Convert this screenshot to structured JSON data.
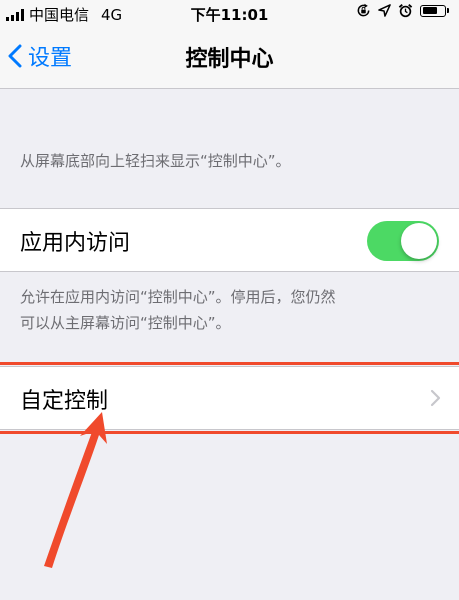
{
  "status_bar": {
    "carrier": "中国电信",
    "network": "4G",
    "time": "下午11:01",
    "icons": [
      "signal-icon",
      "orientation-lock-icon",
      "location-icon",
      "alarm-icon",
      "battery-icon"
    ]
  },
  "nav": {
    "back_label": "设置",
    "title": "控制中心"
  },
  "intro_footnote": "从屏幕底部向上轻扫来显示“控制中心”。",
  "access_in_apps": {
    "label": "应用内访问",
    "enabled": true,
    "footnote_line1": "允许在应用内访问“控制中心”。停用后，您仍然",
    "footnote_line2": "可以从主屏幕访问“控制中心”。"
  },
  "customize": {
    "label": "自定控制"
  },
  "colors": {
    "accent": "#007aff",
    "toggle_on": "#4cd964",
    "highlight": "#f04a2c",
    "background": "#efeff4"
  }
}
